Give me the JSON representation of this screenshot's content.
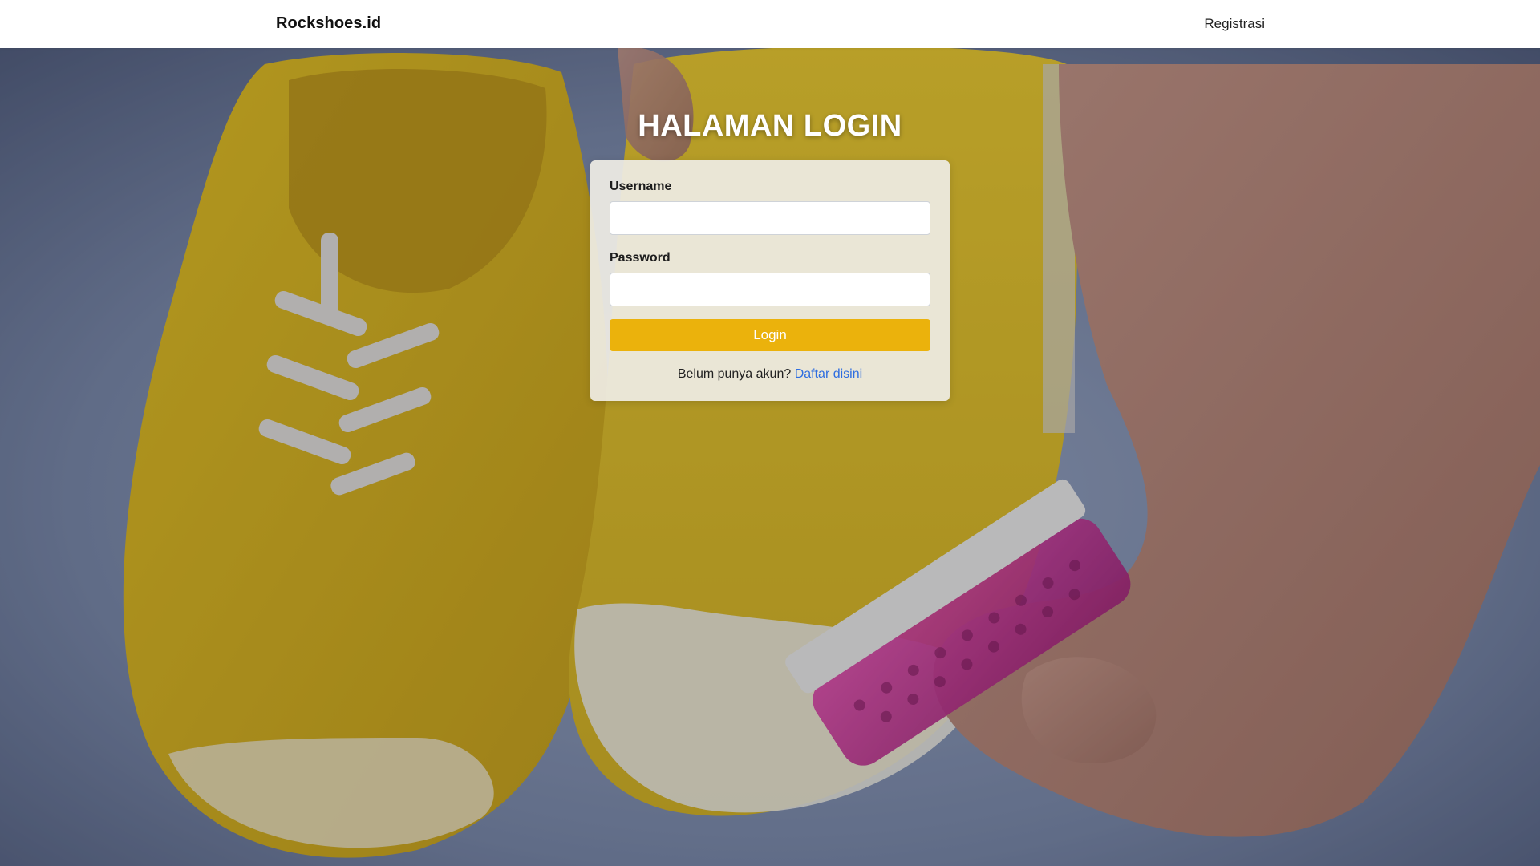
{
  "navbar": {
    "brand": "Rockshoes.id",
    "register_link": "Registrasi"
  },
  "hero": {
    "image_alt": "yellow canvas sneakers being scrubbed with a pink brush in soapy water"
  },
  "login": {
    "title": "HALAMAN LOGIN",
    "username_label": "Username",
    "username_value": "",
    "password_label": "Password",
    "password_value": "",
    "submit_label": "Login",
    "prompt_text": "Belum punya akun?",
    "register_link": "Daftar disini"
  },
  "colors": {
    "accent_button": "#ebb20c",
    "link": "#2f6ee0",
    "card_bg": "#eeece4",
    "navbar_bg": "#ffffff"
  }
}
